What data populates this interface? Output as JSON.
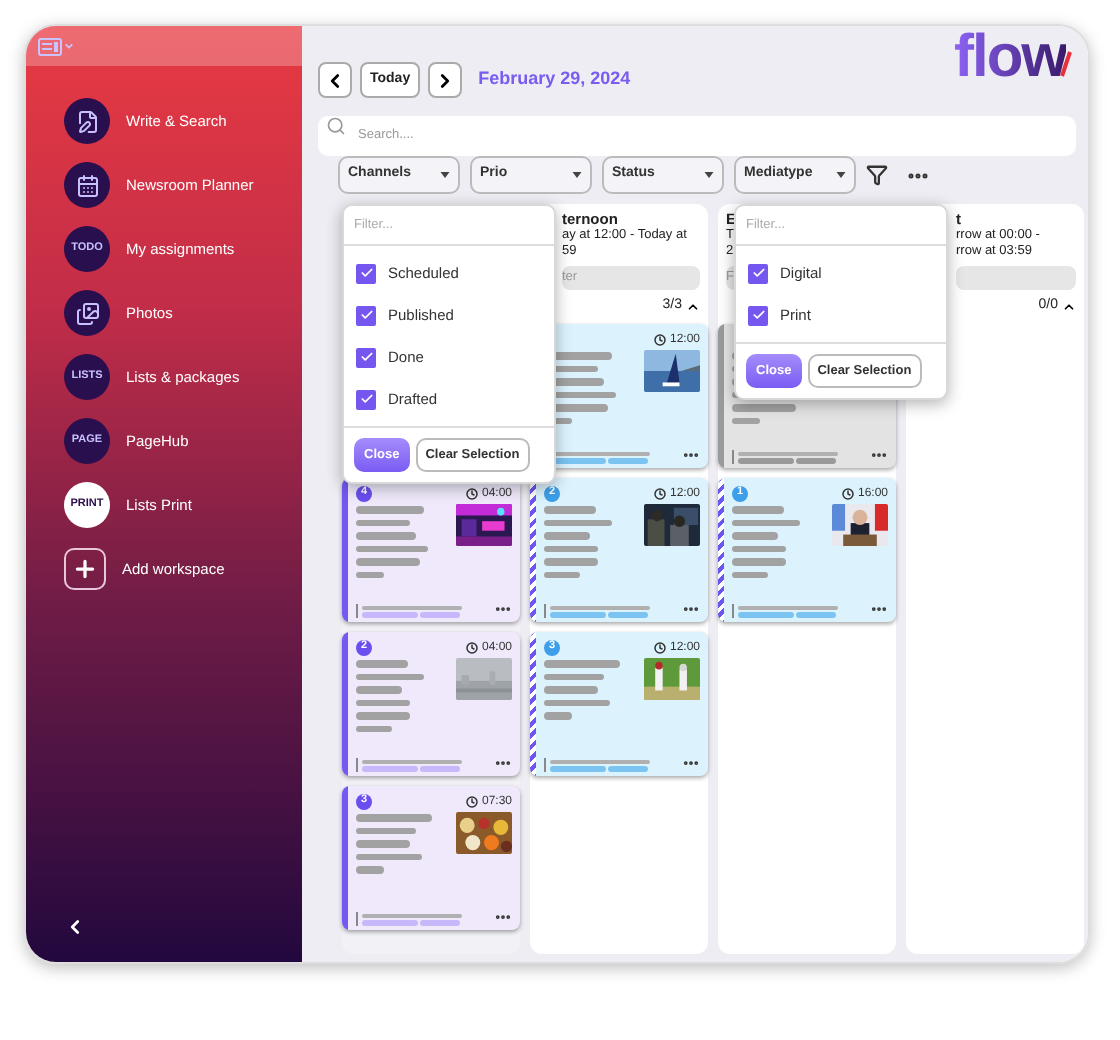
{
  "sidebar": {
    "items": [
      {
        "label": "Write & Search",
        "kind": "icon",
        "selected": false
      },
      {
        "label": "Newsroom Planner",
        "kind": "icon",
        "selected": false
      },
      {
        "label": "My assignments",
        "kind": "text",
        "circle_text": "TODO",
        "selected": false
      },
      {
        "label": "Photos",
        "kind": "icon",
        "selected": false
      },
      {
        "label": "Lists & packages",
        "kind": "text",
        "circle_text": "LISTS",
        "selected": false
      },
      {
        "label": "PageHub",
        "kind": "text",
        "circle_text": "PAGE",
        "selected": false
      },
      {
        "label": "Lists Print",
        "kind": "text",
        "circle_text": "PRINT",
        "selected": true
      },
      {
        "label": "Add workspace",
        "kind": "add",
        "selected": false
      }
    ]
  },
  "logo": "flow",
  "nav": {
    "today": "Today",
    "date": "February 29, 2024"
  },
  "search": {
    "placeholder": "Search...."
  },
  "filters": [
    "Channels",
    "Prio",
    "Status",
    "Mediatype"
  ],
  "dropdowns": [
    {
      "placeholder": "Filter...",
      "options": [
        {
          "label": "Scheduled",
          "checked": true
        },
        {
          "label": "Published",
          "checked": true
        },
        {
          "label": "Done",
          "checked": true
        },
        {
          "label": "Drafted",
          "checked": true
        }
      ],
      "buttons": [
        "Close",
        "Clear Selection"
      ]
    },
    {
      "placeholder": "Filter...",
      "options": [
        {
          "label": "Digital",
          "checked": true
        },
        {
          "label": "Print",
          "checked": true
        }
      ],
      "buttons": [
        "Close",
        "Clear Selection"
      ]
    }
  ],
  "columns": [
    {
      "highlighted": true,
      "cards": [
        {
          "kind": "purple",
          "badge": "4",
          "time": "04:00",
          "picture": true
        },
        {
          "kind": "purple",
          "badge": "2",
          "time": "04:00",
          "picture": true
        },
        {
          "kind": "purple",
          "badge": "3",
          "time": "07:30",
          "picture": true
        }
      ]
    },
    {
      "highlighted": false,
      "title": "ternoon",
      "lines": [
        "ay at 12:00 - Today at",
        "59"
      ],
      "filter_placeholder": "ter",
      "count": "3/3",
      "cards": [
        {
          "kind": "blue",
          "time": "12:00",
          "picture": true
        },
        {
          "kind": "blue",
          "badge": "2",
          "time": "12:00",
          "picture": true
        },
        {
          "kind": "blue",
          "badge": "3",
          "time": "12:00",
          "picture": true
        }
      ]
    },
    {
      "highlighted": false,
      "title": "E",
      "lines": [
        "T",
        "2"
      ],
      "filter_placeholder": "F",
      "cards": [
        {
          "kind": "grey"
        },
        {
          "kind": "blue",
          "badge": "1",
          "time": "16:00",
          "picture": true
        }
      ]
    },
    {
      "highlighted": false,
      "title": "t",
      "lines": [
        "rrow at 00:00 -",
        "rrow at 03:59"
      ],
      "count": "0/0"
    }
  ]
}
